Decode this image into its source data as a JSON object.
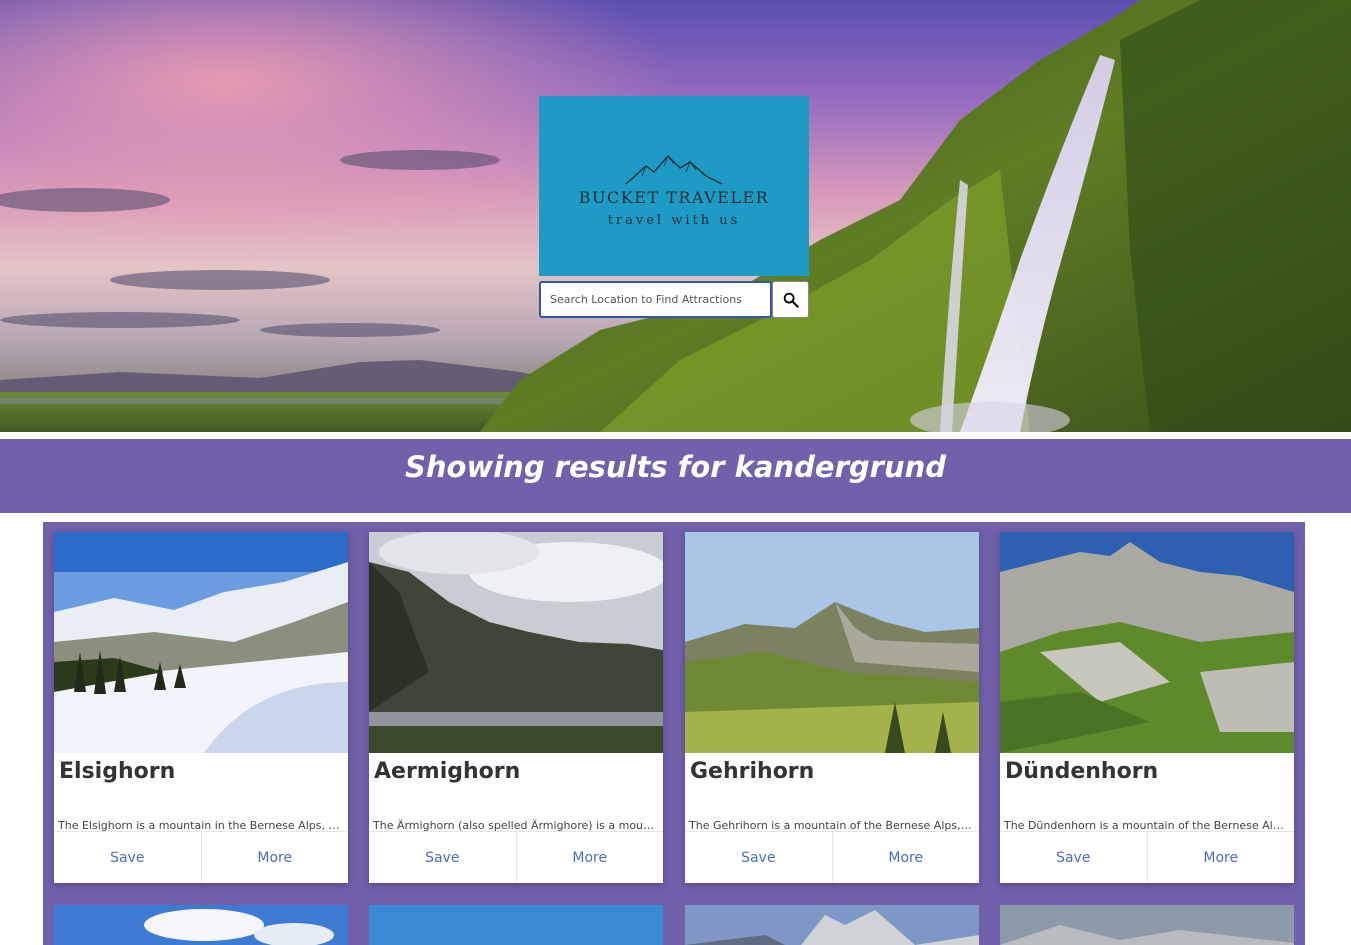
{
  "logo": {
    "title": "BUCKET TRAVELER",
    "tagline": "travel with us",
    "bg_color": "#1e9bc4"
  },
  "search": {
    "placeholder": "Search Location to Find Attractions",
    "value": "",
    "button_icon": "search-icon"
  },
  "results": {
    "heading": "Showing results for kandergrund",
    "banner_color": "#7160aa"
  },
  "cards": [
    {
      "title": "Elsighorn",
      "description": "The Elsighorn is a mountain in the Bernese Alps, overlooking Frutigen",
      "save_label": "Save",
      "more_label": "More"
    },
    {
      "title": "Aermighorn",
      "description": "The Ärmighorn (also spelled Ärmighore) is a mountain of the Bernese Alps",
      "save_label": "Save",
      "more_label": "More"
    },
    {
      "title": "Gehrihorn",
      "description": "The Gehrihorn is a mountain of the Bernese Alps, overlooking Kandergrund",
      "save_label": "Save",
      "more_label": "More"
    },
    {
      "title": "Dündenhorn",
      "description": "The Dündenhorn is a mountain of the Bernese Alps, located in the canton of Bern",
      "save_label": "Save",
      "more_label": "More"
    }
  ],
  "colors": {
    "link": "#4a6fbd",
    "card_title": "#333333"
  }
}
